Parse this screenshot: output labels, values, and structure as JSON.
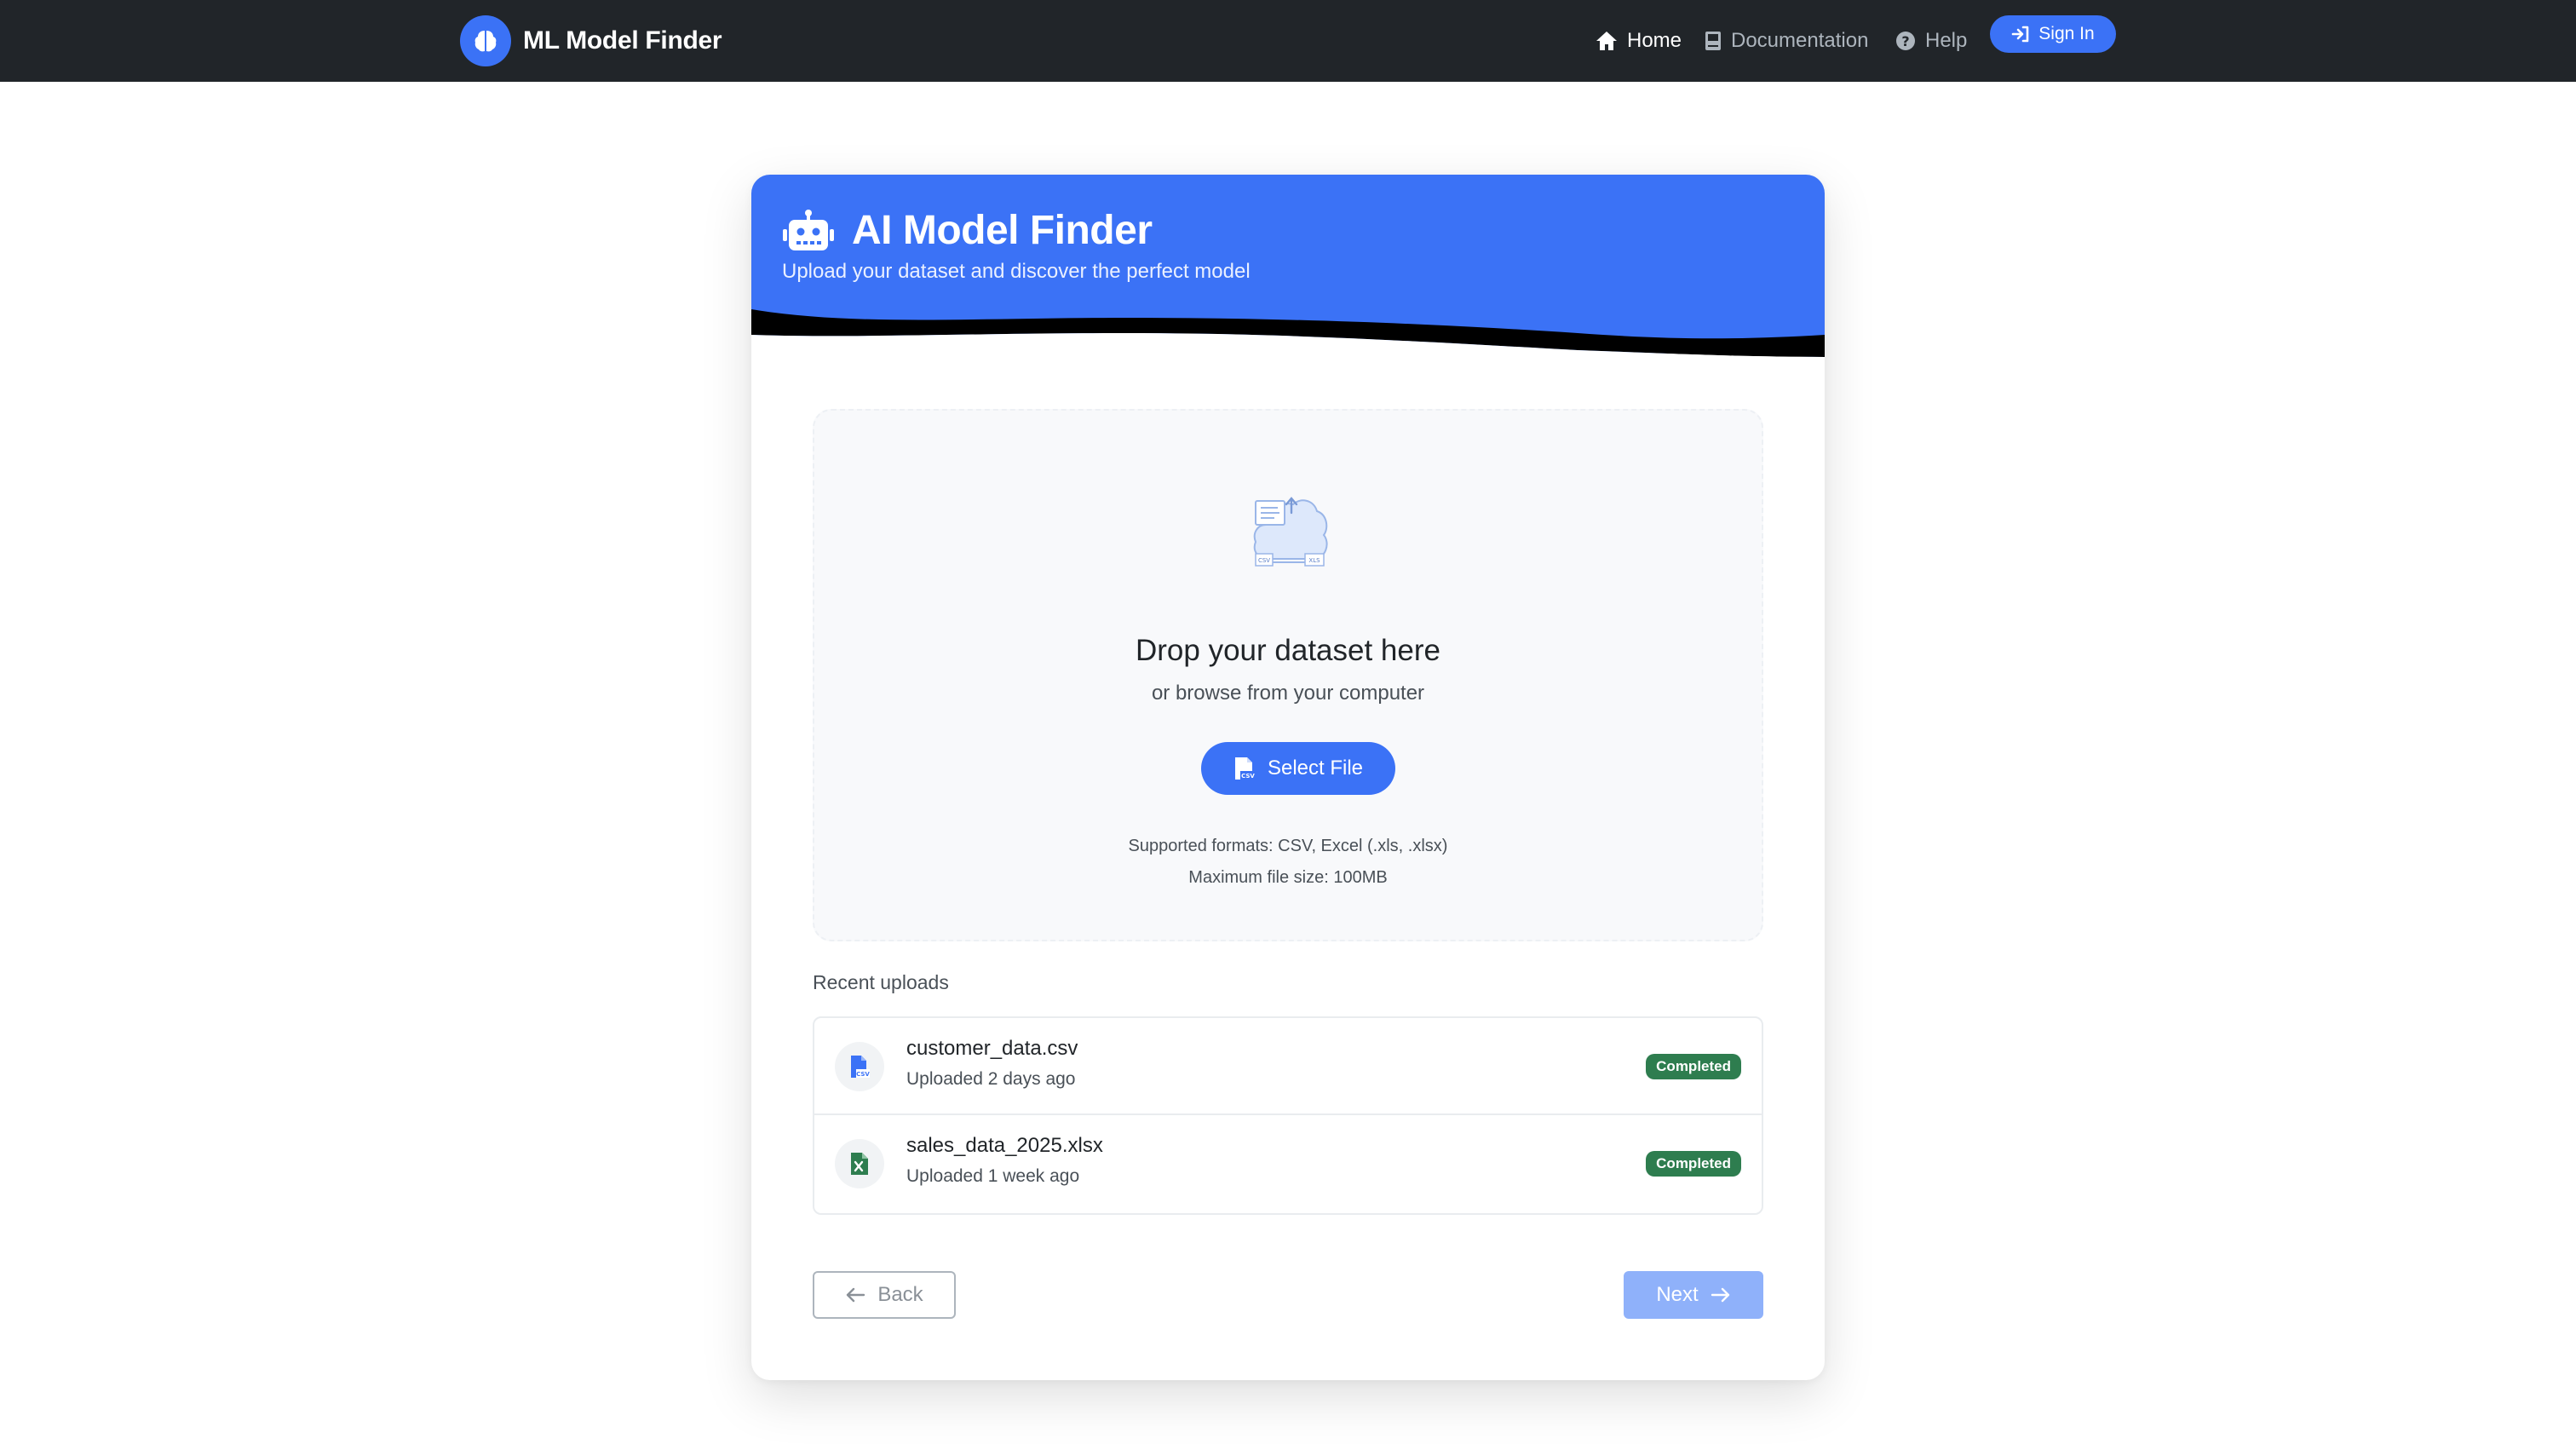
{
  "navbar": {
    "brand": "ML Model Finder",
    "brand_icon": "brain-icon",
    "links": [
      {
        "label": "Home",
        "icon": "home-icon",
        "active": true
      },
      {
        "label": "Documentation",
        "icon": "book-icon",
        "active": false
      },
      {
        "label": "Help",
        "icon": "question-circle-icon",
        "active": false
      }
    ],
    "signin_label": "Sign In"
  },
  "card": {
    "title": "AI Model Finder",
    "subtitle": "Upload your dataset and discover the perfect model",
    "header_icon": "robot-icon"
  },
  "dropzone": {
    "title": "Drop your dataset here",
    "subtitle": "or browse from your computer",
    "select_label": "Select File",
    "formats": "Supported formats: CSV, Excel (.xls, .xlsx)",
    "max_size": "Maximum file size: 100MB",
    "illustration_labels": [
      "CSV",
      "XLS"
    ]
  },
  "recent": {
    "title": "Recent uploads",
    "items": [
      {
        "name": "customer_data.csv",
        "meta": "Uploaded 2 days ago",
        "status": "Completed",
        "icon": "csv-file-icon"
      },
      {
        "name": "sales_data_2025.xlsx",
        "meta": "Uploaded 1 week ago",
        "status": "Completed",
        "icon": "excel-file-icon"
      }
    ]
  },
  "actions": {
    "back_label": "Back",
    "next_label": "Next"
  },
  "colors": {
    "navbar": "#212529",
    "primary": "#3b72f6",
    "primary_disabled": "#8fb1fa",
    "success": "#2e7d4f",
    "dropzone_bg": "#f8f9fb"
  }
}
